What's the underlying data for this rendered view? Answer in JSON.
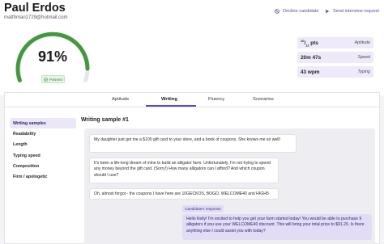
{
  "candidate": {
    "name": "Paul Erdos",
    "email": "matthman1729@hotmail.com"
  },
  "actions": {
    "decline_label": "Decline candidate",
    "send_label": "Send interview request"
  },
  "score": {
    "value": "91%",
    "fraction": 0.91,
    "status": "Passed"
  },
  "stats": [
    {
      "value_num": "10",
      "value_den": "11",
      "value_unit": " pts",
      "label": "Aptitude"
    },
    {
      "value": "20m 47s",
      "label": "Speed"
    },
    {
      "value": "43 wpm",
      "label": "Typing"
    }
  ],
  "tabs": [
    "Aptitude",
    "Writing",
    "Fluency",
    "Scenarios"
  ],
  "active_tab": "Writing",
  "sidebar": {
    "items": [
      "Writing samples",
      "Readability",
      "Length",
      "Typing speed",
      "Composition",
      "Firm / apologetic"
    ]
  },
  "sample": {
    "title": "Writing sample #1",
    "messages": [
      "My daughter just got me a $100 gift card to your store, and a book of coupons. She knows me so well!",
      "It's been a life-long dream of mine to build an alligator farm. Unfortunately, I'm not trying to spend any money beyond the gift card. (Sorry!) How many alligators can I afford? And which coupon should I use?",
      "Oh, almost forgot - the coupons I have here are 10GECKOS, BOGO, WELCOME40 and HIGH5"
    ],
    "response_tag": "Candidate's response",
    "response": "Hello Kelly! I'm excited to help you get your farm started today! You would be able to purchase 9 alligators if you use your WELCOME40 discount. This will bring your total price to $91.20. Is there anything else I could assist you with today?"
  },
  "colors": {
    "accent": "#5b46c9",
    "gauge_fill": "#3f9a3a",
    "gauge_track": "#e6e6ea",
    "pass_green": "#2f8a36"
  }
}
